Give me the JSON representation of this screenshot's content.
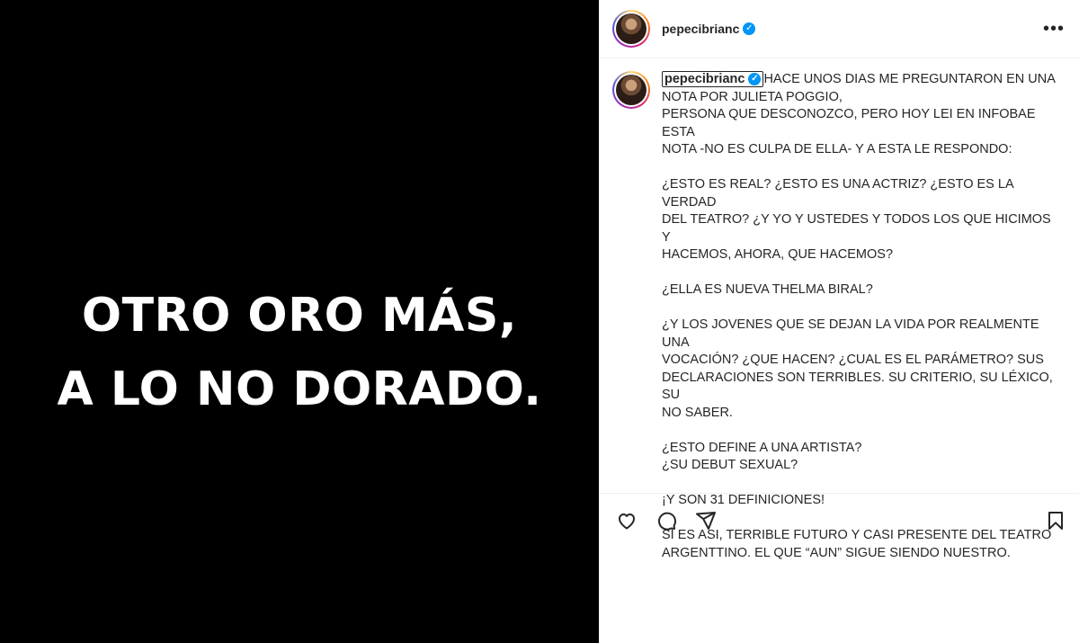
{
  "media": {
    "lines": [
      "OTRO ORO MÁS,",
      "A LO NO DORADO."
    ]
  },
  "post": {
    "username": "pepecibrianc",
    "more_label": "•••",
    "verified_symbol": "✓",
    "caption_lines": [
      "HACE UNOS DIAS ME PREGUNTARON EN UNA",
      "NOTA POR JULIETA POGGIO,",
      "PERSONA QUE DESCONOZCO, PERO HOY LEI EN INFOBAE ESTA",
      "NOTA -NO ES CULPA DE ELLA- Y A ESTA LE RESPONDO:",
      "",
      "¿ESTO ES REAL? ¿ESTO ES UNA ACTRIZ? ¿ESTO ES LA VERDAD",
      "DEL TEATRO? ¿Y YO Y USTEDES Y TODOS LOS QUE HICIMOS Y",
      "HACEMOS, AHORA, QUE HACEMOS?",
      "",
      "¿ELLA ES NUEVA THELMA BIRAL?",
      "",
      "¿Y LOS JOVENES QUE SE DEJAN LA VIDA POR REALMENTE UNA",
      "VOCACIÓN? ¿QUE HACEN? ¿CUAL ES EL PARÁMETRO? SUS",
      "DECLARACIONES SON TERRIBLES. SU CRITERIO, SU LÉXICO, SU",
      "NO SABER.",
      "",
      "¿ESTO DEFINE A UNA ARTISTA?",
      "¿SU DEBUT SEXUAL?",
      "",
      "¡Y SON 31 DEFINICIONES!",
      "",
      "SI ES ASI, TERRIBLE FUTURO Y CASI PRESENTE DEL TEATRO",
      "ARGENTTINO. EL QUE “AUN” SIGUE SIENDO NUESTRO."
    ]
  },
  "actions": {
    "icons": [
      "heart-icon",
      "comment-icon",
      "share-icon",
      "bookmark-icon"
    ]
  },
  "colors": {
    "accent": "#0095f6",
    "text": "#262626",
    "media_bg": "#000000"
  }
}
